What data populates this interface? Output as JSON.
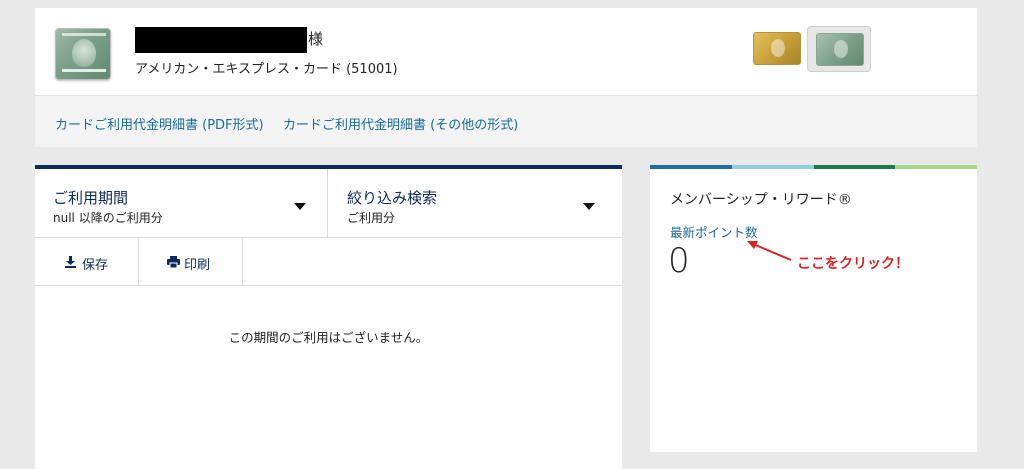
{
  "account": {
    "honorific": "様",
    "card_name": "アメリカン・エキスプレス・カード (51001)"
  },
  "statement_links": [
    {
      "label": "カードご利用代金明細書 (PDF形式)"
    },
    {
      "label": "カードご利用代金明細書 (その他の形式)"
    }
  ],
  "filters": {
    "period": {
      "title": "ご利用期間",
      "sub": "null 以降のご利用分"
    },
    "search": {
      "title": "絞り込み検索",
      "sub": "ご利用分"
    }
  },
  "actions": {
    "save_label": "保存",
    "print_label": "印刷"
  },
  "transactions": {
    "empty_message": "この期間のご利用はございません。"
  },
  "rewards": {
    "title": "メンバーシップ・リワード®",
    "points_link": "最新ポイント数",
    "points_value": "0"
  },
  "annotation": {
    "text": "ここをクリック！",
    "color": "#e02020"
  },
  "colors": {
    "navy": "#0d2a5c",
    "link": "#1a6b9a",
    "bar": [
      "#1f6e9c",
      "#93cbe5",
      "#1e7a4a",
      "#a6d68a"
    ]
  },
  "icons": {
    "save": "download-icon",
    "print": "printer-icon"
  }
}
